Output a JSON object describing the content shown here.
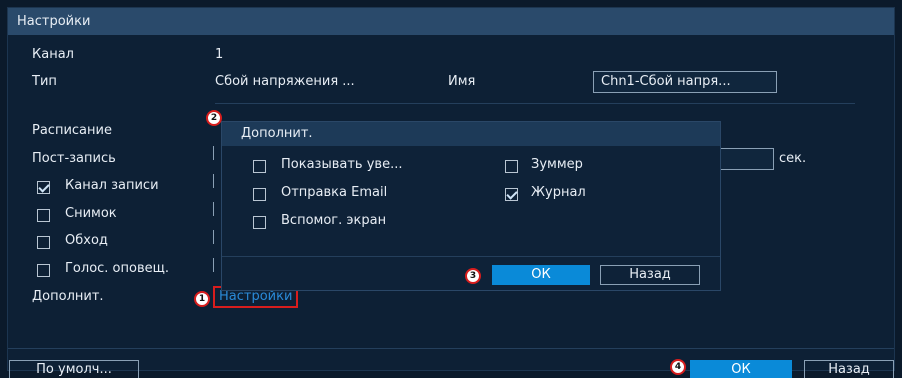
{
  "window": {
    "title": "Настройки"
  },
  "form": {
    "channel_label": "Канал",
    "channel_value": "1",
    "type_label": "Тип",
    "type_value": "Сбой напряжения ...",
    "name_label": "Имя",
    "name_value": "Chn1-Сбой напря...",
    "schedule_label": "Расписание",
    "postrec_label": "Пост-запись",
    "postrec_unit": "сек.",
    "record_channel_label": "Канал записи",
    "record_channel_checked": true,
    "snapshot_label": "Снимок",
    "snapshot_checked": false,
    "tour_label": "Обход",
    "tour_checked": false,
    "voice_label": "Голос. оповещ.",
    "voice_checked": false,
    "more_label": "Дополнит.",
    "settings_link": "Настройки"
  },
  "dialog": {
    "title": "Дополнит.",
    "options": [
      {
        "label": "Показывать уве...",
        "checked": false
      },
      {
        "label": "Зуммер",
        "checked": false
      },
      {
        "label": "Отправка Email",
        "checked": false
      },
      {
        "label": "Журнал",
        "checked": true
      },
      {
        "label": "Вспомог. экран",
        "checked": false
      }
    ],
    "ok_label": "ОК",
    "back_label": "Назад"
  },
  "footer": {
    "default_label": "По умолч...",
    "ok_label": "ОК",
    "back_label": "Назад"
  },
  "markers": [
    "1",
    "2",
    "3",
    "4"
  ],
  "colors": {
    "accent": "#0a8ad8",
    "highlight": "#d71d1d",
    "titlebar": "#2a4a6b"
  }
}
